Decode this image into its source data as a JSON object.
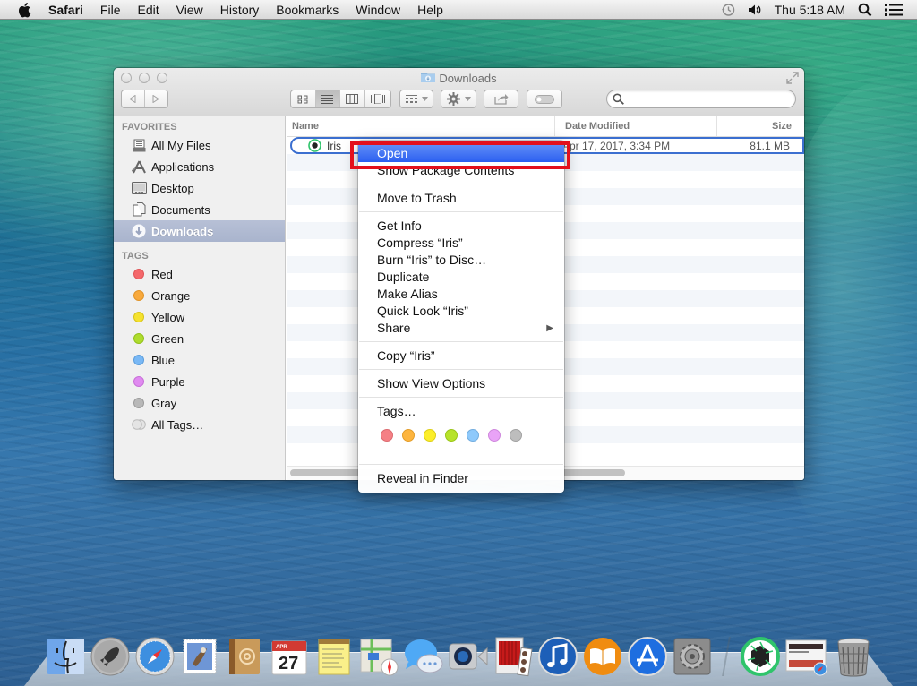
{
  "menubar": {
    "app_name": "Safari",
    "items": [
      "File",
      "Edit",
      "View",
      "History",
      "Bookmarks",
      "Window",
      "Help"
    ],
    "clock": "Thu 5:18 AM",
    "status_icons": [
      "time-machine-icon",
      "volume-icon",
      "spotlight-search-icon",
      "notification-center-icon"
    ]
  },
  "window": {
    "title": "Downloads",
    "search": {
      "placeholder": "",
      "value": ""
    },
    "toolbar": {
      "nav": [
        "back",
        "forward"
      ],
      "view_modes": [
        "icon",
        "list",
        "column",
        "cover-flow"
      ],
      "active_view": "list",
      "buttons": [
        "arrange",
        "action",
        "share",
        "edit-tags"
      ]
    },
    "sidebar": {
      "favorites_header": "FAVORITES",
      "favorites": [
        {
          "label": "All My Files",
          "icon": "all-my-files-icon"
        },
        {
          "label": "Applications",
          "icon": "applications-icon"
        },
        {
          "label": "Desktop",
          "icon": "desktop-icon"
        },
        {
          "label": "Documents",
          "icon": "documents-icon"
        },
        {
          "label": "Downloads",
          "icon": "downloads-icon",
          "selected": true
        }
      ],
      "tags_header": "TAGS",
      "tags": [
        {
          "label": "Red",
          "color": "#f4686b"
        },
        {
          "label": "Orange",
          "color": "#f8a93c"
        },
        {
          "label": "Yellow",
          "color": "#f5e22e"
        },
        {
          "label": "Green",
          "color": "#aedc2d"
        },
        {
          "label": "Blue",
          "color": "#79b8f5"
        },
        {
          "label": "Purple",
          "color": "#e08af0"
        },
        {
          "label": "Gray",
          "color": "#b8b8b8"
        },
        {
          "label": "All Tags…",
          "color": "#d9d9d9"
        }
      ]
    },
    "columns": {
      "name": "Name",
      "date": "Date Modified",
      "size": "Size"
    },
    "files": [
      {
        "name": "Iris",
        "date": "Apr 17, 2017, 3:34 PM",
        "size": "81.1 MB",
        "selected": true
      }
    ]
  },
  "context_menu": {
    "groups": [
      [
        "Open",
        "Show Package Contents"
      ],
      [
        "Move to Trash"
      ],
      [
        "Get Info",
        "Compress “Iris”",
        "Burn “Iris” to Disc…",
        "Duplicate",
        "Make Alias",
        "Quick Look “Iris”",
        "Share"
      ],
      [
        "Copy “Iris”"
      ],
      [
        "Show View Options"
      ],
      [
        "Tags…"
      ],
      [
        "Reveal in Finder"
      ]
    ],
    "highlighted": "Open",
    "submenu_items": [
      "Share"
    ],
    "tag_colors": [
      "#f58085",
      "#fdb53f",
      "#fcee2a",
      "#b7e32a",
      "#8ec9fb",
      "#e9a3f7",
      "#bdbdbd"
    ]
  },
  "dock": {
    "apps": [
      "Finder",
      "Launchpad",
      "Safari",
      "Mail",
      "Contacts",
      "Calendar",
      "Notes",
      "Maps",
      "Messages",
      "FaceTime",
      "Photo Booth",
      "iTunes",
      "iBooks",
      "App Store",
      "System Preferences"
    ],
    "others": [
      "Iris",
      "Safari Window",
      "Trash"
    ],
    "calendar_month": "APR",
    "calendar_day": "27"
  }
}
